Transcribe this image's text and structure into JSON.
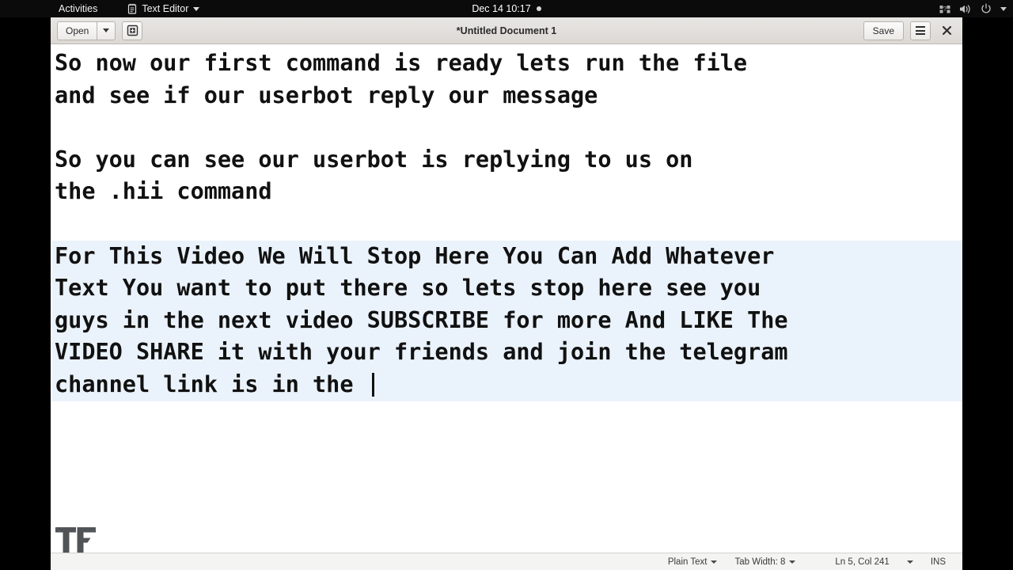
{
  "topbar": {
    "activities": "Activities",
    "app_name": "Text Editor",
    "app_icon": "notepad-icon",
    "clock": "Dec 14  10:17",
    "indicator_icon": "recording-dot-icon",
    "tray_icons": [
      "accessibility-icon",
      "volume-icon",
      "power-icon",
      "chevron-down-icon"
    ]
  },
  "window": {
    "title": "*Untitled Document 1",
    "open_label": "Open",
    "open_dropdown_icon": "chevron-down-icon",
    "new_document_icon": "new-document-icon",
    "save_label": "Save",
    "menu_icon": "hamburger-menu-icon",
    "close_icon": "close-icon"
  },
  "document": {
    "lines": [
      {
        "text": "So now our first command is ready lets run the file",
        "highlight": false
      },
      {
        "text": "and see if our userbot reply our message",
        "highlight": false
      },
      {
        "text": "",
        "highlight": false
      },
      {
        "text": "So you can see our userbot is replying to us on",
        "highlight": false
      },
      {
        "text": "the .hii command",
        "highlight": false
      },
      {
        "text": "",
        "highlight": false
      },
      {
        "text": "For This Video We Will Stop Here You Can Add Whatever",
        "highlight": true
      },
      {
        "text": "Text You want to put there so lets stop here see you",
        "highlight": true
      },
      {
        "text": "guys in the next video SUBSCRIBE for more And LIKE The",
        "highlight": true
      },
      {
        "text": "VIDEO SHARE it with your friends and join the telegram",
        "highlight": true
      },
      {
        "text": "channel link is in the ",
        "highlight": true,
        "caret": true
      }
    ],
    "watermark_icon": "tf-logo-watermark",
    "highlight_color": "#eaf2fb",
    "text_color": "#111111"
  },
  "statusbar": {
    "language": "Plain Text",
    "tab_width": "Tab Width: 8",
    "position": "Ln 5, Col 241",
    "overwrite_mode": "INS",
    "caret_icon": "chevron-down-icon"
  }
}
